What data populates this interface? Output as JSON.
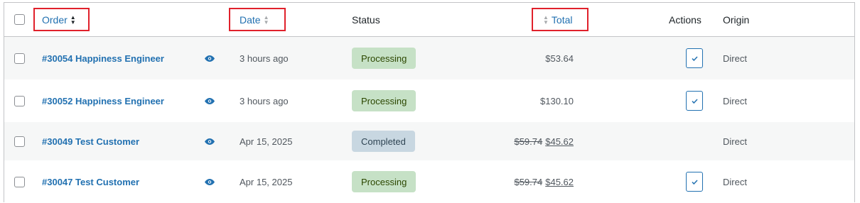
{
  "header": {
    "order": "Order",
    "date": "Date",
    "status": "Status",
    "total": "Total",
    "actions": "Actions",
    "origin": "Origin"
  },
  "colors": {
    "link": "#2271b1",
    "processing_bg": "#c6e1c6",
    "completed_bg": "#c8d7e1",
    "highlight_box": "#e0212b"
  },
  "orders": [
    {
      "order": "#30054 Happiness Engineer",
      "date": "3 hours ago",
      "status": "Processing",
      "total": "$53.64",
      "total_original": "",
      "has_action": true,
      "origin": "Direct"
    },
    {
      "order": "#30052 Happiness Engineer",
      "date": "3 hours ago",
      "status": "Processing",
      "total": "$130.10",
      "total_original": "",
      "has_action": true,
      "origin": "Direct"
    },
    {
      "order": "#30049 Test Customer",
      "date": "Apr 15, 2025",
      "status": "Completed",
      "total": "$45.62",
      "total_original": "$59.74",
      "has_action": false,
      "origin": "Direct"
    },
    {
      "order": "#30047 Test Customer",
      "date": "Apr 15, 2025",
      "status": "Processing",
      "total": "$45.62",
      "total_original": "$59.74",
      "has_action": true,
      "origin": "Direct"
    }
  ],
  "icons": {
    "preview": "eye-icon",
    "complete_action": "checkmark-icon",
    "sort_desc": "sort-desc-icon",
    "sort_both": "sort-arrows-icon"
  }
}
